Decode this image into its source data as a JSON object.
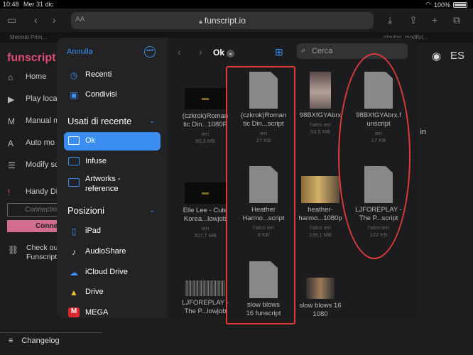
{
  "status_bar": {
    "time": "10:48",
    "date": "Mer 31 dic",
    "battery": "100%"
  },
  "browser": {
    "url": "funscript.io",
    "aa_label": "AA",
    "tabs": [
      "Metroid Prim...",
      "...",
      "playing, modifyi..."
    ]
  },
  "app": {
    "brand": "funscript",
    "nav": [
      {
        "icon": "home-icon",
        "glyph": "⌂",
        "label": "Home"
      },
      {
        "icon": "play-icon",
        "glyph": "▶",
        "label": "Play local"
      },
      {
        "icon": "manual-icon",
        "glyph": "M",
        "label": "Manual m"
      },
      {
        "icon": "auto-icon",
        "glyph": "A",
        "label": "Auto mo"
      },
      {
        "icon": "sliders-icon",
        "glyph": "☰",
        "label": "Modify sc"
      },
      {
        "icon": "alert-icon",
        "glyph": "!",
        "label": "Handy Di"
      }
    ],
    "connection_placeholder": "Connectio",
    "connect_label": "Conne",
    "check_line1": "Check ou",
    "check_line2": "Funscript",
    "changelog": "Changelog",
    "right_letter": "in"
  },
  "picker": {
    "cancel": "Annulla",
    "sidebar_top": [
      {
        "icon": "clock-icon",
        "glyph": "◷",
        "label": "Recenti"
      },
      {
        "icon": "shared-folder-icon",
        "glyph": "▣",
        "label": "Condivisi"
      }
    ],
    "recent_header": "Usati di recente",
    "recent_folders": [
      {
        "label": "Ok",
        "selected": true
      },
      {
        "label": "Infuse",
        "selected": false
      },
      {
        "label": "Artworks -",
        "label2": "reference",
        "selected": false
      }
    ],
    "locations_header": "Posizioni",
    "locations": [
      {
        "icon": "ipad-icon",
        "glyph": "▯",
        "label": "iPad"
      },
      {
        "icon": "audioshare-icon",
        "glyph": "♪",
        "label": "AudioShare"
      },
      {
        "icon": "icloud-icon",
        "glyph": "☁",
        "label": "iCloud Drive"
      },
      {
        "icon": "drive-icon",
        "glyph": "▲",
        "label": "Drive"
      },
      {
        "icon": "mega-icon",
        "glyph": "M",
        "label": "MEGA"
      }
    ],
    "folder_title": "Ok",
    "search_placeholder": "Cerca",
    "files": [
      {
        "kind": "vid",
        "name1": "(czkrok)Roman",
        "name2": "tic Din...1080P",
        "date": "ieri",
        "size": "90,3 MB"
      },
      {
        "kind": "doc",
        "name1": "(czkrok)Roman",
        "name2": "tic Din...script",
        "date": "ieri",
        "size": "27 KB"
      },
      {
        "kind": "photo",
        "name1": "98BXfGYAbrx",
        "name2": "",
        "date": "l'altro ieri",
        "size": "53,5 MB"
      },
      {
        "kind": "doc",
        "name1": "98BXfGYAbrx.f",
        "name2": "unscript",
        "date": "ieri",
        "size": "17 KB"
      },
      {
        "kind": "vid",
        "name1": "Elle Lee - Cute",
        "name2": "Korea...lowjob",
        "date": "ieri",
        "size": "307,7 MB"
      },
      {
        "kind": "doc",
        "name1": "Heather",
        "name2": "Harmo...script",
        "date": "l'altro ieri",
        "size": "8 KB"
      },
      {
        "kind": "photo2",
        "name1": "heather-",
        "name2": "harmo...1080p",
        "date": "l'altro ieri",
        "size": "139,1 MB"
      },
      {
        "kind": "doc",
        "name1": "LJFOREPLAY -",
        "name2": "The P...script",
        "date": "l'altro ieri",
        "size": "122 KB"
      },
      {
        "kind": "noise",
        "name1": "LJFOREPLAY -",
        "name2": "The P...lowjob",
        "date": "",
        "size": ""
      },
      {
        "kind": "doc",
        "name1": "slow blows",
        "name2": "16 funscript",
        "date": "",
        "size": ""
      },
      {
        "kind": "pic3",
        "name1": "slow blows 16",
        "name2": "1080",
        "date": "",
        "size": ""
      }
    ]
  },
  "colors": {
    "accent": "#3b8ef0",
    "brand": "#e04d76",
    "annotation": "#e23a3a"
  }
}
